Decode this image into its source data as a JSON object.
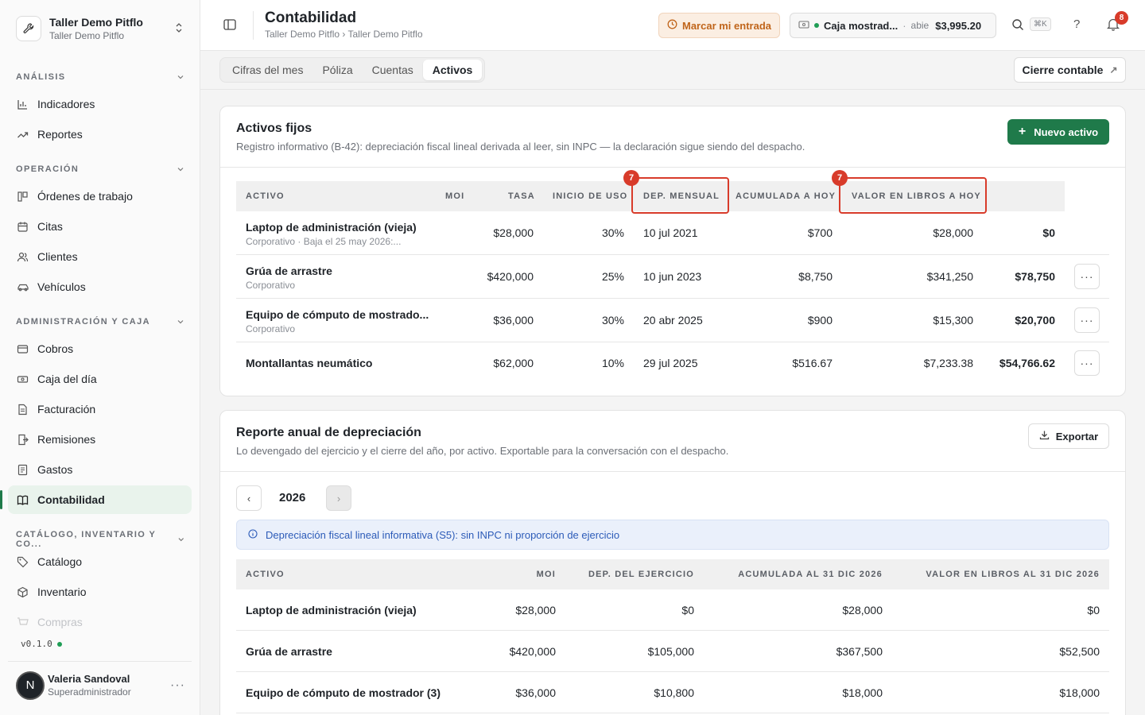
{
  "org": {
    "name": "Taller Demo Pitflo",
    "subtitle": "Taller Demo Pitflo"
  },
  "sidebar": {
    "sections": [
      {
        "label": "ANÁLISIS"
      },
      {
        "label": "OPERACIÓN"
      },
      {
        "label": "ADMINISTRACIÓN Y CAJA"
      },
      {
        "label": "CATÁLOGO, INVENTARIO Y CO..."
      }
    ],
    "items": [
      {
        "label": "Indicadores",
        "icon": "bar-chart-icon"
      },
      {
        "label": "Reportes",
        "icon": "trend-icon"
      },
      {
        "label": "Órdenes de trabajo",
        "icon": "work-orders-icon"
      },
      {
        "label": "Citas",
        "icon": "calendar-icon"
      },
      {
        "label": "Clientes",
        "icon": "users-icon"
      },
      {
        "label": "Vehículos",
        "icon": "car-icon"
      },
      {
        "label": "Cobros",
        "icon": "wallet-icon"
      },
      {
        "label": "Caja del día",
        "icon": "cash-icon"
      },
      {
        "label": "Facturación",
        "icon": "invoice-icon"
      },
      {
        "label": "Remisiones",
        "icon": "remission-icon"
      },
      {
        "label": "Gastos",
        "icon": "expense-icon"
      },
      {
        "label": "Contabilidad",
        "icon": "book-icon"
      },
      {
        "label": "Catálogo",
        "icon": "tag-icon"
      },
      {
        "label": "Inventario",
        "icon": "box-icon"
      },
      {
        "label": "Compras",
        "icon": "cart-icon"
      }
    ],
    "version": "v0.1.0"
  },
  "user": {
    "initial": "N",
    "name": "Valeria Sandoval",
    "role": "Superadministrador"
  },
  "header": {
    "title": "Contabilidad",
    "breadcrumb": "Taller Demo Pitflo › Taller Demo Pitflo",
    "checkin_label": "Marcar mi entrada",
    "register": {
      "name": "Caja mostrad...",
      "separator": "·",
      "status": "abie",
      "amount": "$3,995.20"
    },
    "shortcut": "⌘K",
    "notifications": "8"
  },
  "tabs": [
    {
      "label": "Cifras del mes"
    },
    {
      "label": "Póliza"
    },
    {
      "label": "Cuentas"
    },
    {
      "label": "Activos"
    }
  ],
  "cierre_label": "Cierre contable",
  "assets": {
    "title": "Activos fijos",
    "description": "Registro informativo (B-42): depreciación fiscal lineal derivada al leer, sin INPC — la declaración sigue siendo del despacho.",
    "new_button": "Nuevo activo",
    "columns": [
      "ACTIVO",
      "MOI",
      "TASA",
      "INICIO DE USO",
      "DEP. MENSUAL",
      "ACUMULADA A HOY",
      "VALOR EN LIBROS A HOY"
    ],
    "marker_label": "7",
    "rows": [
      {
        "name": "Laptop de administración (vieja)",
        "sub": "Corporativo · Baja el 25 may 2026:...",
        "moi": "$28,000",
        "tasa": "30%",
        "inicio": "10 jul 2021",
        "mensual": "$700",
        "acumulada": "$28,000",
        "libros": "$0"
      },
      {
        "name": "Grúa de arrastre",
        "sub": "Corporativo",
        "moi": "$420,000",
        "tasa": "25%",
        "inicio": "10 jun 2023",
        "mensual": "$8,750",
        "acumulada": "$341,250",
        "libros": "$78,750"
      },
      {
        "name": "Equipo de cómputo de mostrado...",
        "sub": "Corporativo",
        "moi": "$36,000",
        "tasa": "30%",
        "inicio": "20 abr 2025",
        "mensual": "$900",
        "acumulada": "$15,300",
        "libros": "$20,700"
      },
      {
        "name": "Montallantas neumático",
        "sub": "",
        "moi": "$62,000",
        "tasa": "10%",
        "inicio": "29 jul 2025",
        "mensual": "$516.67",
        "acumulada": "$7,233.38",
        "libros": "$54,766.62"
      }
    ]
  },
  "report": {
    "title": "Reporte anual de depreciación",
    "description": "Lo devengado del ejercicio y el cierre del año, por activo. Exportable para la conversación con el despacho.",
    "export_button": "Exportar",
    "year": "2026",
    "info": "Depreciación fiscal lineal informativa (S5): sin INPC ni proporción de ejercicio",
    "columns": [
      "ACTIVO",
      "MOI",
      "DEP. DEL EJERCICIO",
      "ACUMULADA AL 31 DIC 2026",
      "VALOR EN LIBROS AL 31 DIC 2026"
    ],
    "rows": [
      {
        "name": "Laptop de administración (vieja)",
        "moi": "$28,000",
        "ejercicio": "$0",
        "acumulada": "$28,000",
        "libros": "$0"
      },
      {
        "name": "Grúa de arrastre",
        "moi": "$420,000",
        "ejercicio": "$105,000",
        "acumulada": "$367,500",
        "libros": "$52,500"
      },
      {
        "name": "Equipo de cómputo de mostrador (3)",
        "moi": "$36,000",
        "ejercicio": "$10,800",
        "acumulada": "$18,000",
        "libros": "$18,000"
      }
    ]
  }
}
